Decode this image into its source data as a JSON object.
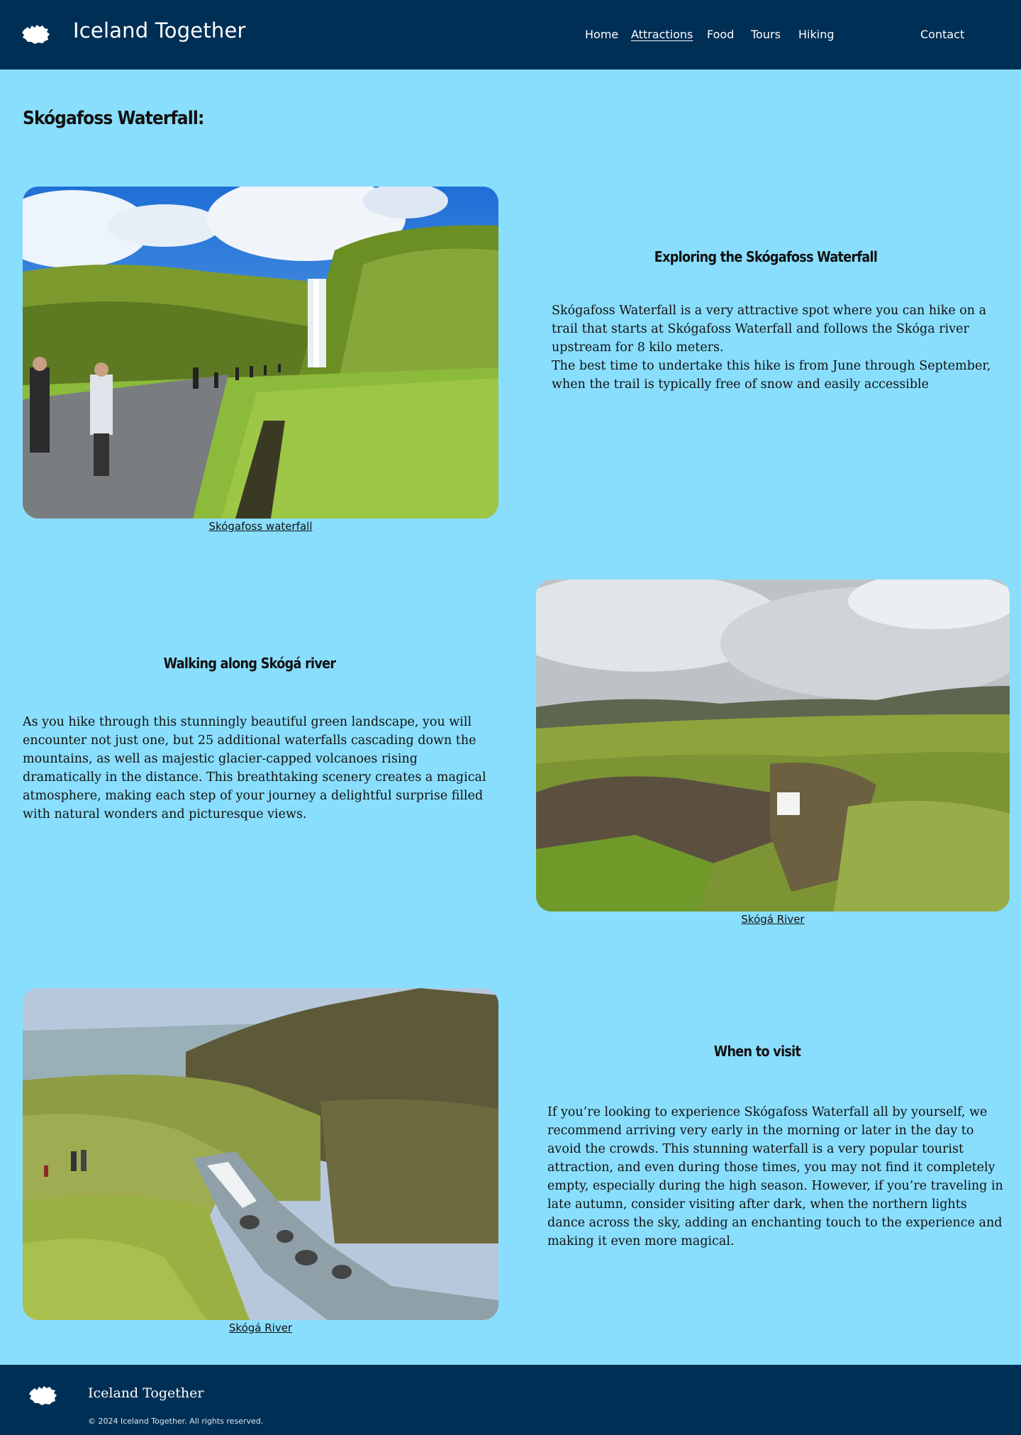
{
  "header": {
    "brand": "Iceland Together",
    "logo_icon": "iceland-map-icon",
    "nav": [
      {
        "label": "Home",
        "active": false
      },
      {
        "label": "Attractions",
        "active": true
      },
      {
        "label": "Food",
        "active": false
      },
      {
        "label": "Tours",
        "active": false
      },
      {
        "label": "Hiking",
        "active": false
      },
      {
        "label": "Contact",
        "active": false
      }
    ]
  },
  "page": {
    "title": "Skógafoss Waterfall:"
  },
  "sections": [
    {
      "heading": "Exploring the Skógafoss Waterfall",
      "text": "Skógafoss Waterfall is a very attractive  spot where you can hike on a trail that starts at Skógafoss Waterfall and follows the Skóga river upstream for 8 kilo meters.\nThe best time to undertake this hike is from June through September, when the trail is typically free of snow and easily accessible",
      "caption": "Skógafoss waterfall"
    },
    {
      "heading": "Walking along Skógá river",
      "text": "As you hike through this stunningly beautiful green landscape, you will encounter not just one, but 25 additional waterfalls cascading down the mountains, as well as majestic glacier-capped volcanoes rising dramatically in the distance. This breathtaking scenery creates a magical atmosphere, making each step of your journey a delightful surprise filled with natural wonders and picturesque views.",
      "caption": "Skógá River"
    },
    {
      "heading": "When to visit",
      "text": "If you’re looking to experience Skógafoss Waterfall all by yourself, we recommend arriving very early in the morning or later in the day to avoid the crowds. This stunning waterfall is a very popular tourist attraction, and even during those times, you may not find it completely empty, especially during the high season. However, if you’re traveling in late autumn, consider visiting after dark, when the northern lights dance across the sky, adding an enchanting touch to the experience and making it even more magical.",
      "caption": "Skógá River"
    }
  ],
  "footer": {
    "brand": "Iceland Together",
    "copyright": "© 2024 Iceland Together. All rights reserved."
  }
}
